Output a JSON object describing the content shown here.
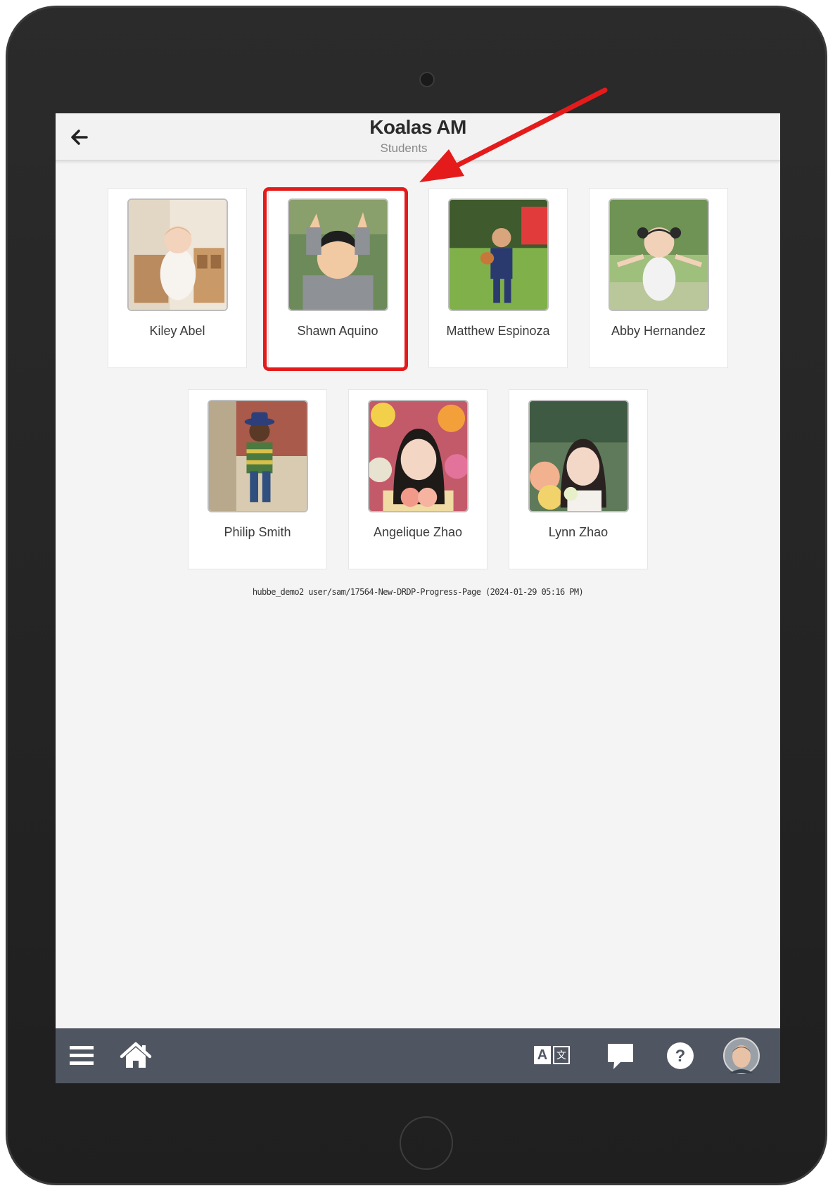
{
  "header": {
    "title": "Koalas AM",
    "subtitle": "Students"
  },
  "students": [
    {
      "name": "Kiley Abel"
    },
    {
      "name": "Shawn Aquino"
    },
    {
      "name": "Matthew Espinoza"
    },
    {
      "name": "Abby Hernandez"
    },
    {
      "name": "Philip Smith"
    },
    {
      "name": "Angelique Zhao"
    },
    {
      "name": "Lynn Zhao"
    }
  ],
  "build_info": "hubbe_demo2 user/sam/17564-New-DRDP-Progress-Page (2024-01-29 05:16 PM)",
  "bottom_bar": {
    "translate_icon_text": "A 文"
  },
  "annotations": {
    "highlight_color": "#e51b1b"
  }
}
